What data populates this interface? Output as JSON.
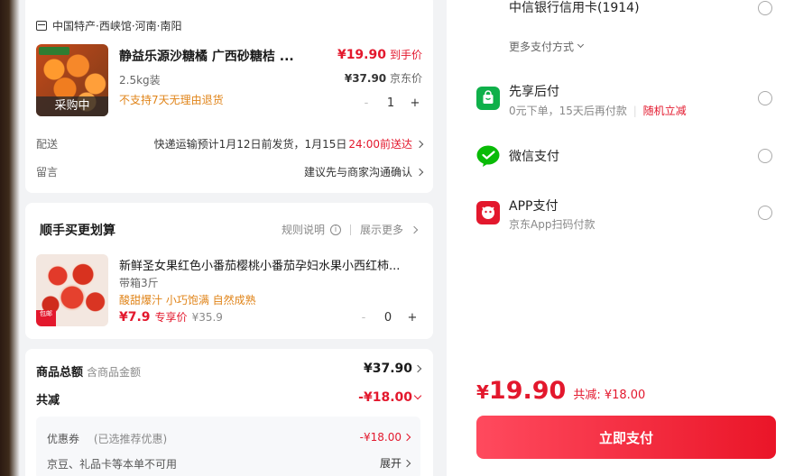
{
  "product": {
    "shop": "中国特产·西峡馆·河南·南阳",
    "title": "静益乐源沙糖橘 广西砂糖桔 ...",
    "price": "¥19.90",
    "price_note": "到手价",
    "spec": "2.5kg装",
    "orig_price": "¥37.90",
    "orig_note": "京东价",
    "warning": "不支持7天无理由退货",
    "status_overlay": "采购中",
    "qty": "1",
    "minus": "-",
    "plus": "+"
  },
  "delivery": {
    "label": "配送",
    "value": "快递运输预计1月12日前发货，1月15日",
    "highlight": "24:00前送达"
  },
  "message": {
    "label": "留言",
    "value": "建议先与商家沟通确认"
  },
  "addon": {
    "title": "顺手买更划算",
    "rules": "规则说明",
    "more": "展示更多",
    "item": {
      "title": "新鲜圣女果红色小番茄樱桃小番茄孕妇水果小西红柿...",
      "spec": "带箱3斤",
      "tags": "酸甜爆汁  小巧饱满  自然成熟",
      "price": "¥7.9",
      "price_note": "专享价",
      "orig_price": "¥35.9",
      "badge": "包邮",
      "qty": "0",
      "minus": "-",
      "plus": "+"
    }
  },
  "summary": {
    "goods_label": "商品总额",
    "goods_sub": "含商品金额",
    "goods_value": "¥37.90",
    "reduce_label": "共减",
    "reduce_value": "-¥18.00",
    "coupon_label": "优惠券",
    "coupon_sub": "(已选推荐优惠)",
    "coupon_value": "-¥18.00",
    "jingdou_label": "京豆、礼品卡等本单不可用",
    "expand": "展开"
  },
  "payment": {
    "bank_card": "中信银行信用卡(1914)",
    "more_methods": "更多支付方式",
    "methods": [
      {
        "title": "先享后付",
        "sub": "0元下单，15天后再付款",
        "sub_highlight": "随机立减",
        "icon": "shopping-bag-icon",
        "color": "#0fb04a"
      },
      {
        "title": "微信支付",
        "sub": "",
        "icon": "wechat-pay-icon",
        "color": "#09bb07"
      },
      {
        "title": "APP支付",
        "sub": "京东App扫码付款",
        "icon": "jd-app-icon",
        "color": "#e3182d"
      }
    ],
    "total_yen": "¥",
    "total_amount": "19.90",
    "total_reduce": "共减: ¥18.00",
    "pay_button": "立即支付"
  }
}
